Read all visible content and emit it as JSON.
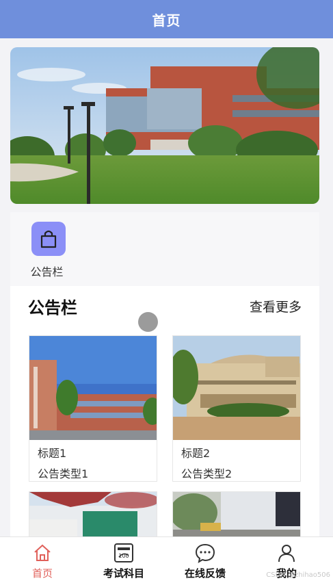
{
  "header": {
    "title": "首页"
  },
  "quick_nav": {
    "items": [
      {
        "label": "公告栏",
        "icon": "shopping-bag-icon"
      }
    ]
  },
  "notice": {
    "title": "公告栏",
    "more_label": "查看更多",
    "cards": [
      {
        "title": "标题1",
        "type": "公告类型1"
      },
      {
        "title": "标题2",
        "type": "公告类型2"
      }
    ]
  },
  "tabbar": {
    "items": [
      {
        "label": "首页",
        "icon": "home-icon",
        "active": true
      },
      {
        "label": "考试科目",
        "icon": "exam-paper-icon",
        "active": false
      },
      {
        "label": "在线反馈",
        "icon": "chat-bubble-icon",
        "active": false
      },
      {
        "label": "我的",
        "icon": "user-icon",
        "active": false
      }
    ]
  },
  "watermark": "CSDN @zhihao506",
  "colors": {
    "header": "#6f8fdc",
    "accent": "#e0605a",
    "nav_icon": "#8b8ff7"
  }
}
